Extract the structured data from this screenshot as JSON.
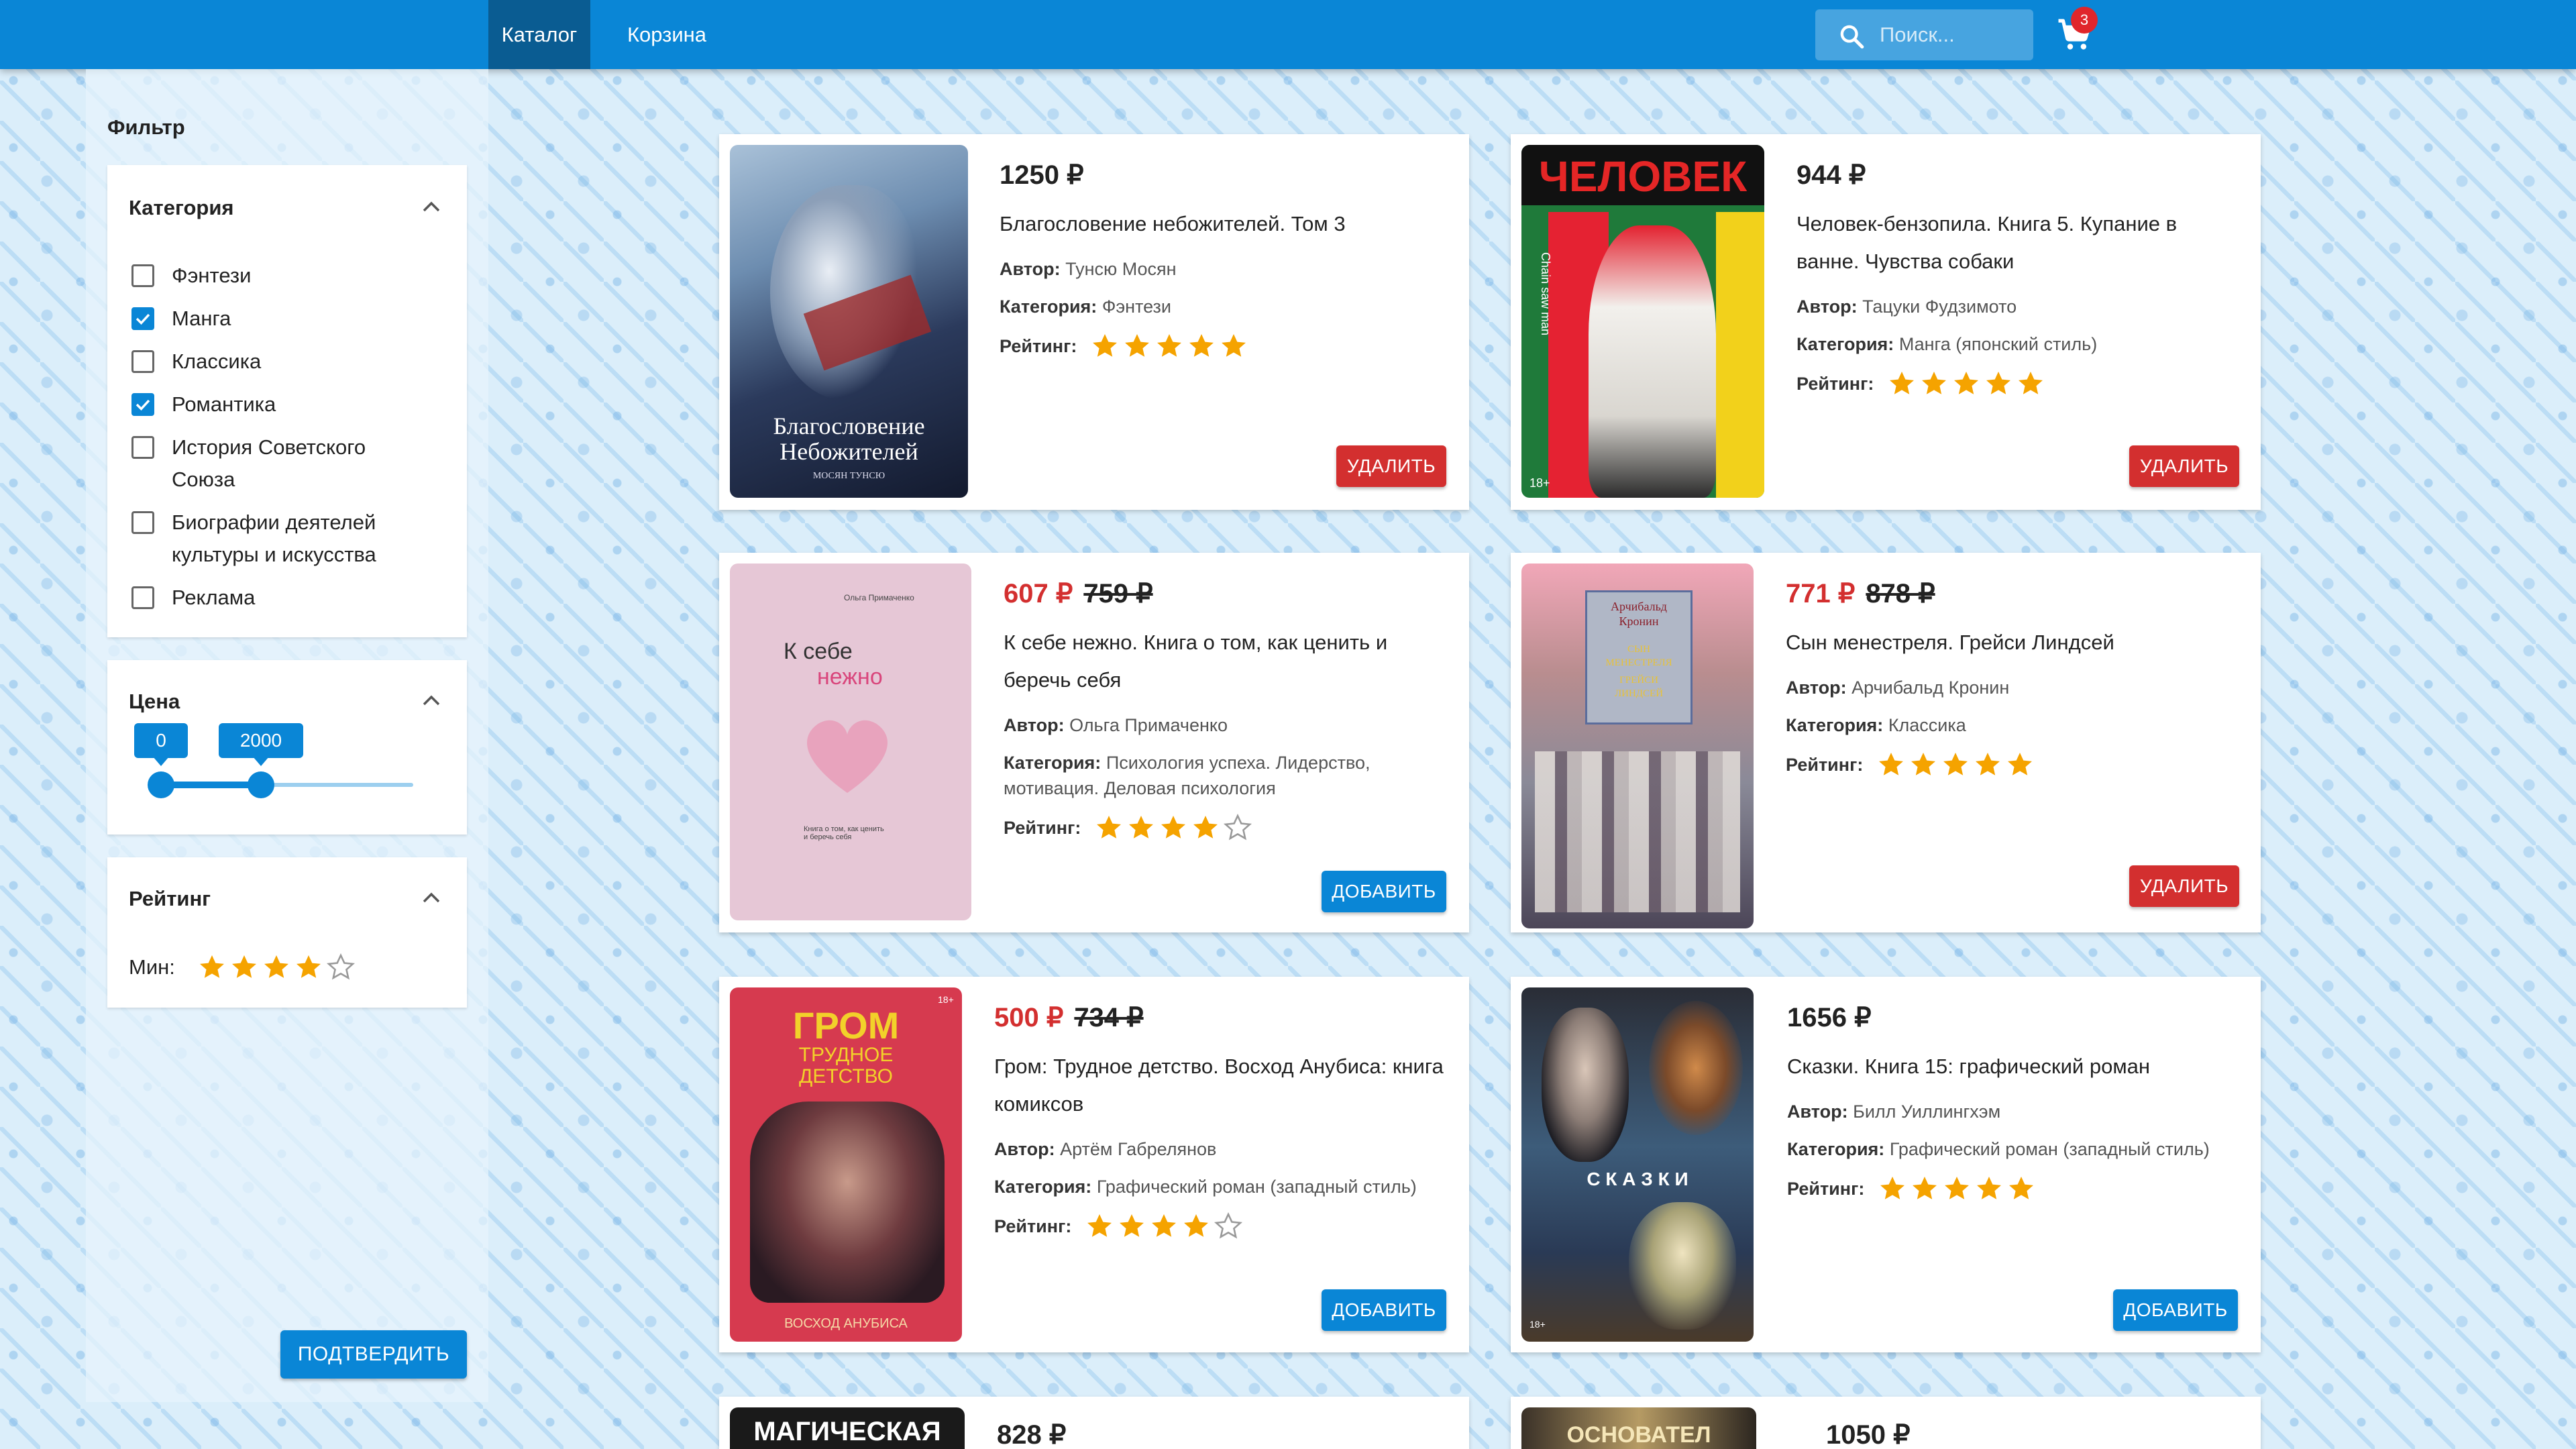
{
  "nav": {
    "catalog": "Каталог",
    "cart": "Корзина"
  },
  "search": {
    "placeholder": "Поиск..."
  },
  "cart": {
    "count": "3"
  },
  "filter": {
    "title": "Фильтр",
    "category": {
      "title": "Категория",
      "items": [
        {
          "label": "Фэнтези",
          "checked": false
        },
        {
          "label": "Манга",
          "checked": true
        },
        {
          "label": "Классика",
          "checked": false
        },
        {
          "label": "Романтика",
          "checked": true
        },
        {
          "label": "История Советского Союза",
          "checked": false
        },
        {
          "label": "Биографии деятелей культуры и искусства",
          "checked": false
        },
        {
          "label": "Реклама",
          "checked": false
        }
      ]
    },
    "price": {
      "title": "Цена",
      "min": "0",
      "max": "2000"
    },
    "rating": {
      "title": "Рейтинг",
      "min_label": "Мин:",
      "min_value": 4
    },
    "confirm": "ПОДТВЕРДИТЬ"
  },
  "labels": {
    "author": "Автор:",
    "category": "Категория:",
    "rating": "Рейтинг:",
    "add": "ДОБАВИТЬ",
    "remove": "УДАЛИТЬ"
  },
  "products": [
    {
      "price": "1250 ₽",
      "old_price": "",
      "title": "Благословение небожителей. Том 3",
      "author": "Тунсю Мосян",
      "category": "Фэнтези",
      "rating": 5,
      "in_cart": true,
      "cover_text": [
        "Благословение",
        "Небожителей",
        "МОСЯН ТУНСЮ"
      ]
    },
    {
      "price": "944 ₽",
      "old_price": "",
      "title": "Человек-бензопила. Книга 5. Купание в ванне. Чувства собаки",
      "author": "Тацуки Фудзимото",
      "category": "Манга (японский стиль)",
      "rating": 5,
      "in_cart": true,
      "cover_text": [
        "ЧЕЛОВЕК",
        "Chain saw man",
        "18+"
      ]
    },
    {
      "price": "607 ₽",
      "old_price": "759 ₽",
      "title": "К себе нежно. Книга о том, как ценить и беречь себя",
      "author": "Ольга Примаченко",
      "category": "Психология успеха. Лидерство, мотивация. Деловая психология",
      "rating": 4,
      "in_cart": false,
      "cover_text": [
        "Ольга Примаченко",
        "К себе",
        "нежно",
        "Книга о том, как ценить и беречь себя"
      ]
    },
    {
      "price": "771 ₽",
      "old_price": "878 ₽",
      "title": "Сын менестреля. Грейси Линдсей",
      "author": "Арчибальд Кронин",
      "category": "Классика",
      "rating": 5,
      "in_cart": true,
      "cover_text": [
        "Арчибальд",
        "Кронин",
        "СЫН",
        "МЕНЕСТРЕЛЯ",
        "ГРЕЙСИ",
        "ЛИНДСЕЙ"
      ]
    },
    {
      "price": "500 ₽",
      "old_price": "734 ₽",
      "title": "Гром: Трудное детство. Восход Анубиса: книга комиксов",
      "author": "Артём Габрелянов",
      "category": "Графический роман (западный стиль)",
      "rating": 4,
      "in_cart": false,
      "cover_text": [
        "ГРОМ",
        "ТРУДНОЕ",
        "ДЕТСТВО",
        "ВОСХОД АНУБИСА",
        "18+"
      ]
    },
    {
      "price": "1656 ₽",
      "old_price": "",
      "title": "Сказки. Книга 15: графический роман",
      "author": "Билл Уиллингхэм",
      "category": "Графический роман (западный стиль)",
      "rating": 5,
      "in_cart": false,
      "cover_text": [
        "С К А З К И",
        "18+"
      ]
    },
    {
      "price": "828 ₽",
      "old_price": "",
      "cover_text": [
        "МАГИЧЕСКАЯ"
      ]
    },
    {
      "price": "1050 ₽",
      "old_price": "",
      "cover_text": [
        "ОСНОВАТЕЛ"
      ]
    }
  ],
  "colors": {
    "accent": "#0a86d6",
    "danger": "#d32f2f",
    "star": "#f5a300"
  }
}
